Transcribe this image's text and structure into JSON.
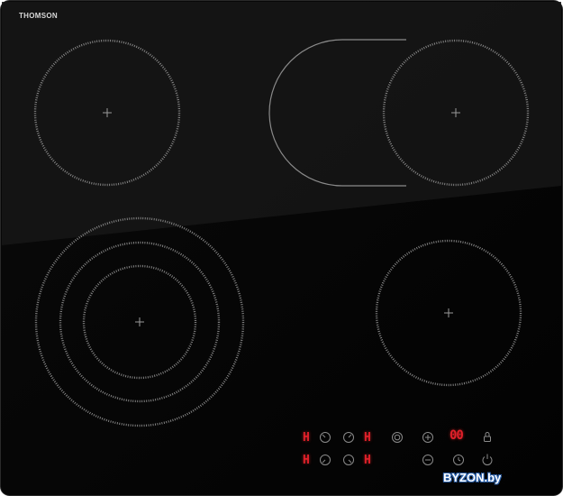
{
  "brand": {
    "name": "THOMSON"
  },
  "controls": {
    "zone_digit": "H",
    "timer_display": "00"
  },
  "watermark": {
    "text": "BYZON.by"
  },
  "colors": {
    "glass": "#050505",
    "glass_highlight": "#1c1c1c",
    "ring": "#9a9a9a",
    "display_red": "#e0202a",
    "watermark_outline": "#2a5fa8"
  },
  "icons": [
    "zone-selector-icon",
    "plus-icon",
    "minus-icon",
    "timer-icon",
    "lock-icon",
    "power-icon",
    "boost-icon"
  ]
}
